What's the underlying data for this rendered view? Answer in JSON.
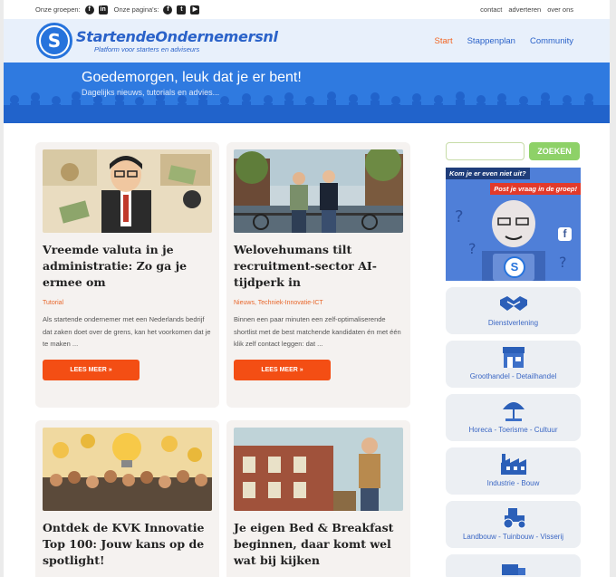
{
  "topbar": {
    "groups_label": "Onze groepen:",
    "pages_label": "Onze pagina's:",
    "links": [
      "contact",
      "adverteren",
      "over ons"
    ]
  },
  "logo": {
    "badge_letter": "S",
    "name": "StartendeOndernemersnl",
    "tagline": "Platform voor starters en adviseurs"
  },
  "nav": {
    "items": [
      "Start",
      "Stappenplan",
      "Community"
    ],
    "active": "Start"
  },
  "banner": {
    "greeting": "Goedemorgen, leuk dat je er bent!",
    "subtitle": "Dagelijks nieuws, tutorials en advies..."
  },
  "articles": [
    {
      "title": "Vreemde valuta in je administratie: Zo ga je ermee om",
      "category": "Tutorial",
      "excerpt": "Als startende ondernemer met een Nederlands bedrijf dat zaken doet over de grens, kan het voorkomen dat je te maken ...",
      "button": "LEES MEER »"
    },
    {
      "title": "Welovehumans tilt recruitment-sector AI-tijdperk in",
      "category": "Nieuws, Techniek-Innovatie-ICT",
      "excerpt": "Binnen een paar minuten een zelf-optimaliserende shortlist met de best matchende kandidaten én met één klik zelf contact leggen: dat ...",
      "button": "LEES MEER »"
    },
    {
      "title": "Ontdek de KVK Innovatie Top 100: Jouw kans op de spotlight!"
    },
    {
      "title": "Je eigen Bed & Breakfast beginnen, daar komt wel wat bij kijken"
    }
  ],
  "search": {
    "placeholder": "",
    "button": "ZOEKEN"
  },
  "promo": {
    "line1": "Kom je er even niet uit?",
    "line2": "Post je vraag in de groep!",
    "badge": "S"
  },
  "categories": [
    {
      "label": "Dienstverlening",
      "icon": "handshake-icon"
    },
    {
      "label": "Groothandel - Detailhandel",
      "icon": "shop-icon"
    },
    {
      "label": "Horeca - Toerisme - Cultuur",
      "icon": "beach-umbrella-icon"
    },
    {
      "label": "Industrie - Bouw",
      "icon": "factory-icon"
    },
    {
      "label": "Landbouw - Tuinbouw - Visserij",
      "icon": "tractor-icon"
    }
  ],
  "colors": {
    "brand_blue": "#2673dc",
    "accent_orange": "#f34e14",
    "search_green": "#8ed168"
  }
}
